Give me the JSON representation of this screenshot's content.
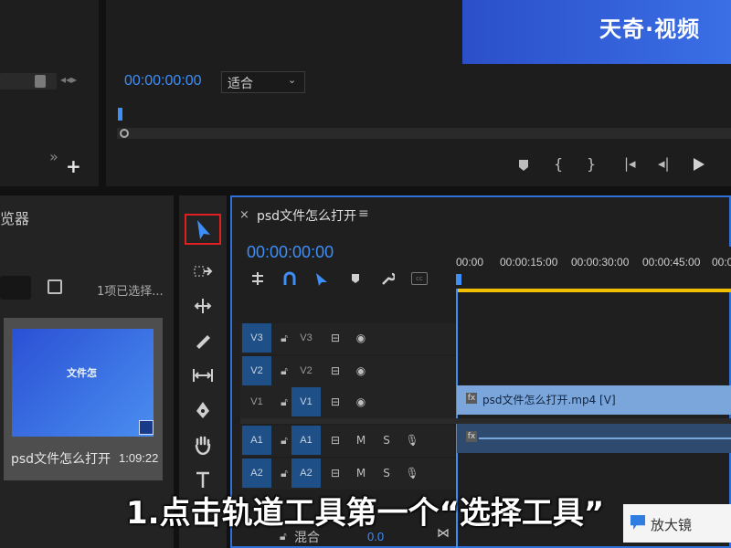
{
  "watermark": {
    "brand": "天奇·视频"
  },
  "program_monitor": {
    "timecode": "00:00:00:00",
    "fit_select": "适合",
    "controls": [
      "marker-icon",
      "mark-in-icon",
      "mark-out-icon",
      "go-to-in-icon",
      "step-back-icon",
      "play-icon"
    ]
  },
  "left_top_panel": {
    "add_label": "+",
    "more_label": "»"
  },
  "project_panel": {
    "title_fragment": "览器",
    "selection_status": "1项已选择...",
    "clip": {
      "name": "psd文件怎么打开",
      "duration": "1:09:22",
      "thumb_text": "文件怎"
    }
  },
  "tools": [
    "selection-tool",
    "track-select-tool",
    "ripple-edit-tool",
    "razor-tool",
    "slip-tool",
    "pen-tool",
    "hand-tool",
    "type-tool"
  ],
  "timeline": {
    "close_label": "×",
    "sequence_name": "psd文件怎么打开",
    "menu_label": "≡",
    "timecode": "00:00:00:00",
    "ruler": [
      "00:00",
      "00:00:15:00",
      "00:00:30:00",
      "00:00:45:00",
      "00:00"
    ],
    "video_tracks": [
      {
        "src": "V3",
        "target": "V3"
      },
      {
        "src": "V2",
        "target": "V2"
      },
      {
        "src": "V1",
        "target": "V1"
      }
    ],
    "audio_tracks": [
      {
        "src": "A1",
        "target": "A1",
        "mute": "M",
        "solo": "S"
      },
      {
        "src": "A2",
        "target": "A2",
        "mute": "M",
        "solo": "S"
      }
    ],
    "video_clip_label": "psd文件怎么打开.mp4 [V]",
    "fx_label": "fx",
    "mix_label": "混合",
    "mix_value": "0.0"
  },
  "subtitle": "1.点击轨道工具第一个“选择工具”",
  "magnifier": {
    "label": "放大镜"
  },
  "colors": {
    "accent_blue": "#3e8ef7",
    "highlight_red": "#e02020",
    "playhead_yellow": "#f0c000",
    "clip_blue": "#7aa6dc"
  }
}
